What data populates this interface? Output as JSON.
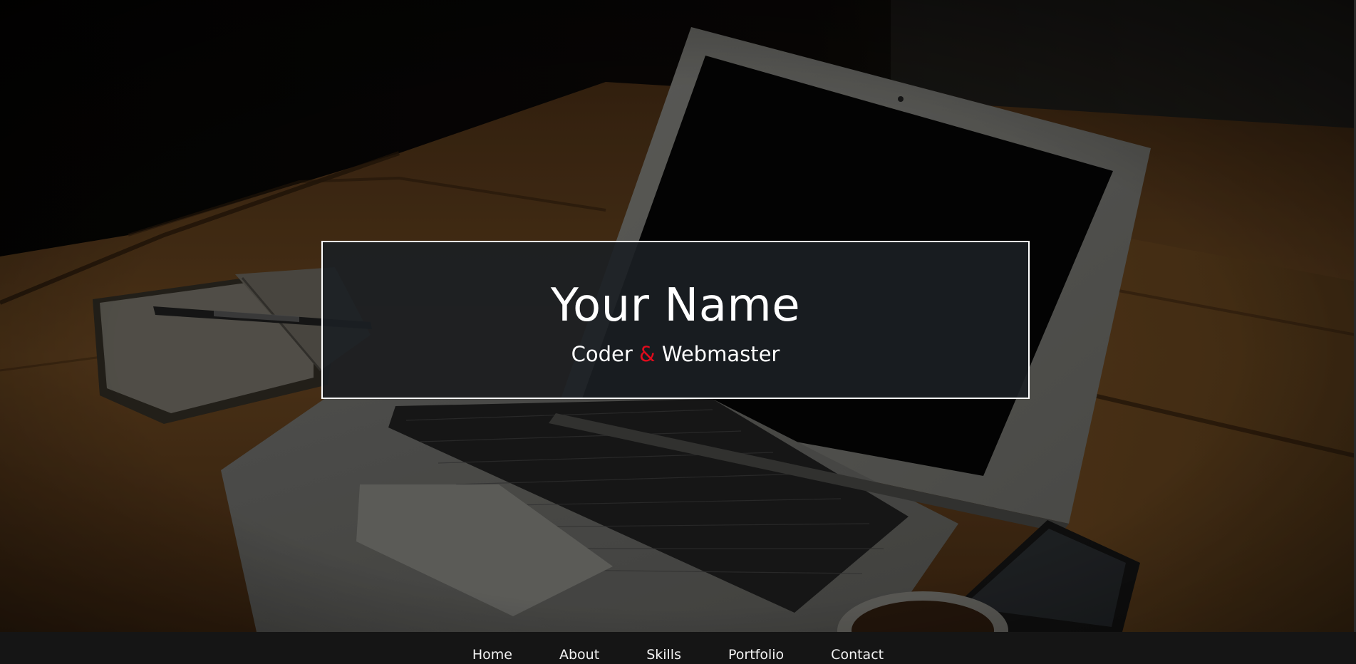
{
  "hero": {
    "name": "Your Name",
    "subtitle_part1": "Coder",
    "subtitle_amp": "&",
    "subtitle_part2": "Webmaster",
    "accent_color": "#e00b1c",
    "box_border_color": "#ffffff",
    "box_background": "#1b1f24"
  },
  "nav": {
    "background": "#151515",
    "items": [
      {
        "label": "Home"
      },
      {
        "label": "About"
      },
      {
        "label": "Skills"
      },
      {
        "label": "Portfolio"
      },
      {
        "label": "Contact"
      }
    ]
  }
}
